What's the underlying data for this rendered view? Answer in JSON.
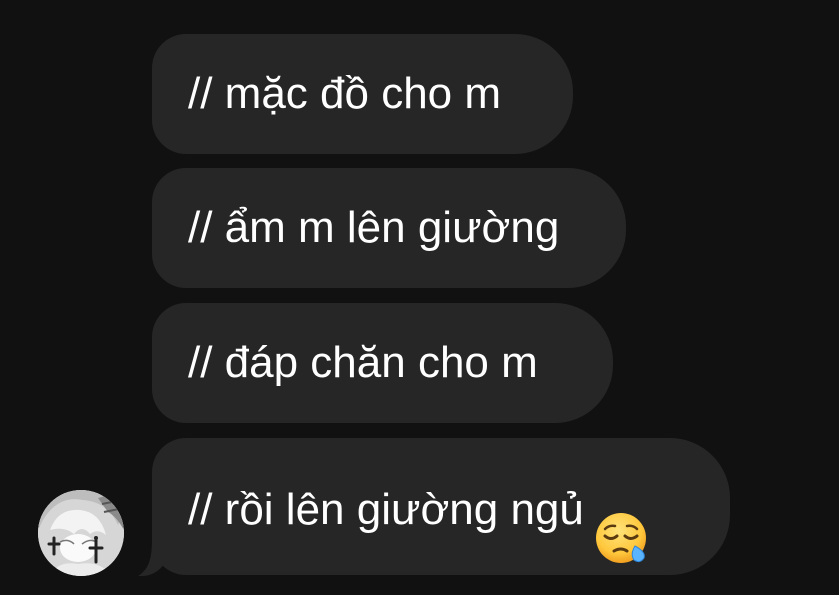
{
  "messages": [
    {
      "text": "// mặc đồ cho m"
    },
    {
      "text": "// ẩm m lên giường"
    },
    {
      "text": "// đáp chăn cho m"
    },
    {
      "text": "// rồi lên giường ngủ",
      "emoji": "sleepy-face-emoji"
    }
  ],
  "colors": {
    "background": "#111111",
    "bubble": "#262626",
    "text": "#ffffff"
  },
  "avatar": {
    "icon": "profile-avatar"
  }
}
